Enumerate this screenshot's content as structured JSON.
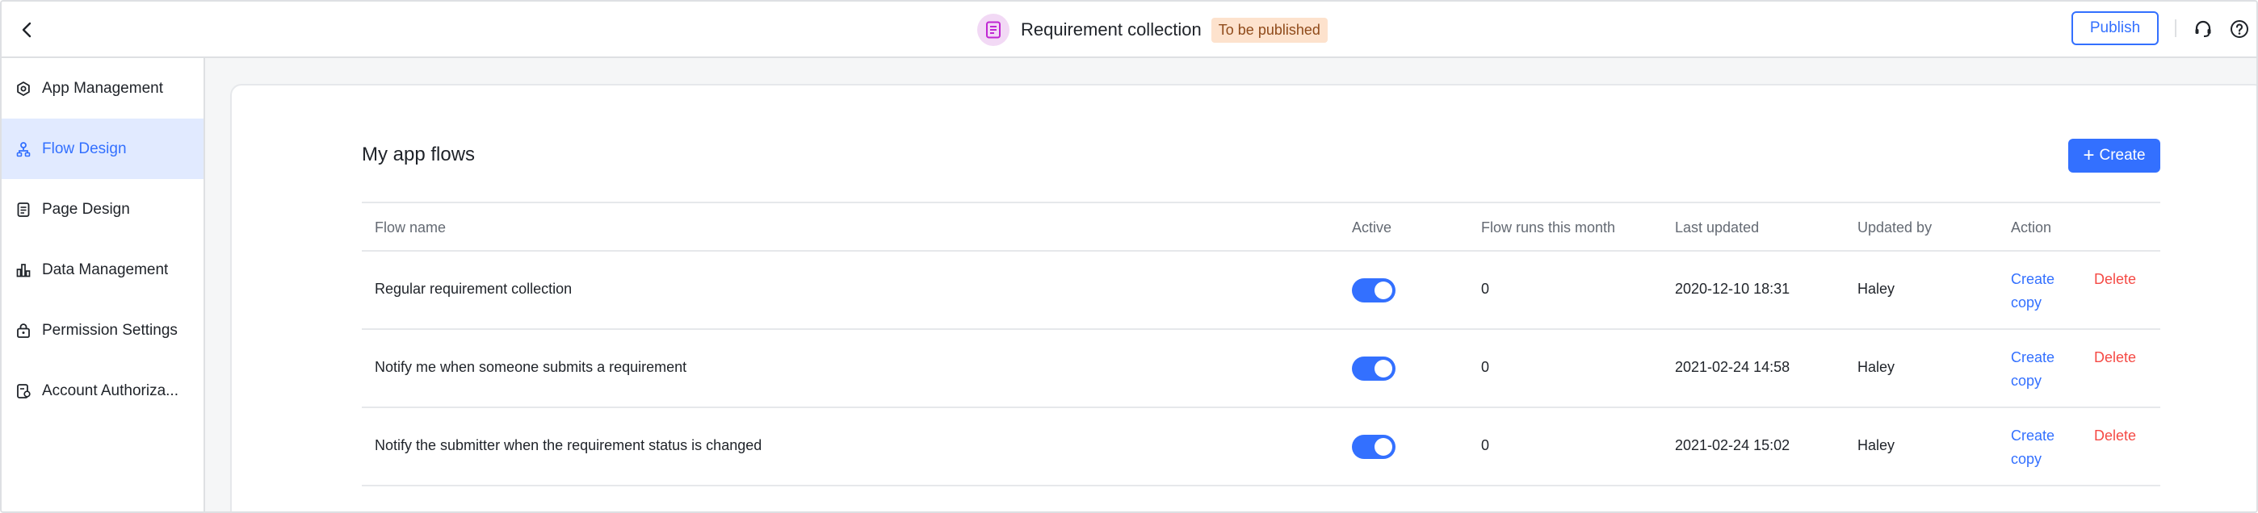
{
  "header": {
    "title": "Requirement collection",
    "status": "To be published",
    "publish_label": "Publish"
  },
  "sidebar": {
    "items": [
      {
        "label": "App Management",
        "icon": "gear-icon"
      },
      {
        "label": "Flow Design",
        "icon": "flow-icon",
        "active": true
      },
      {
        "label": "Page Design",
        "icon": "page-icon"
      },
      {
        "label": "Data Management",
        "icon": "chart-icon"
      },
      {
        "label": "Permission Settings",
        "icon": "lock-icon"
      },
      {
        "label": "Account Authoriza...",
        "icon": "account-icon"
      }
    ]
  },
  "main": {
    "title": "My app flows",
    "create_label": "Create",
    "columns": [
      "Flow name",
      "Active",
      "Flow runs this month",
      "Last updated",
      "Updated by",
      "Action"
    ],
    "rows": [
      {
        "name": "Regular requirement collection",
        "active": true,
        "runs": "0",
        "updated": "2020-12-10 18:31",
        "by": "Haley"
      },
      {
        "name": "Notify me when someone submits a requirement",
        "active": true,
        "runs": "0",
        "updated": "2021-02-24 14:58",
        "by": "Haley"
      },
      {
        "name": "Notify the submitter when the requirement status is changed",
        "active": true,
        "runs": "0",
        "updated": "2021-02-24 15:02",
        "by": "Haley"
      }
    ],
    "actions": {
      "copy": "Create copy",
      "delete": "Delete"
    }
  },
  "colors": {
    "accent": "#3370ff",
    "danger": "#f54a45",
    "badge_bg": "#fde2cd",
    "active_nav_bg": "#e1eaff"
  }
}
